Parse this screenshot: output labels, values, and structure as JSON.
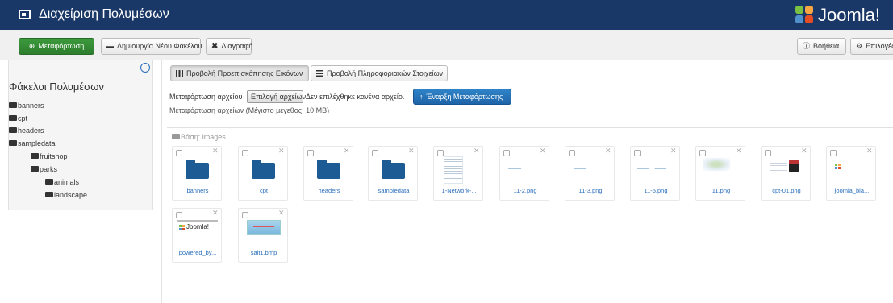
{
  "header": {
    "title": "Διαχείριση Πολυμέσων",
    "title_icon": "media-icon",
    "logo_text": "Joomla!",
    "colors": {
      "bar": "#1a3867",
      "logo_red": "#e44d26",
      "logo_orange": "#f9a541",
      "logo_green": "#7ac143",
      "logo_blue": "#5091cd"
    }
  },
  "toolbar": {
    "upload_label": "Μεταφόρτωση",
    "new_folder_label": "Δημιουργία Νέου Φακέλου",
    "delete_label": "Διαγραφή",
    "help_label": "Βοήθεια",
    "options_label": "Επιλογές"
  },
  "sidebar": {
    "title": "Φάκελοι Πολυμέσων",
    "items": [
      {
        "label": "banners"
      },
      {
        "label": "cpt"
      },
      {
        "label": "headers"
      },
      {
        "label": "sampledata"
      },
      {
        "label": "fruitshop"
      },
      {
        "label": "parks"
      },
      {
        "label": "animals"
      },
      {
        "label": "landscape"
      }
    ]
  },
  "main": {
    "tabs": [
      {
        "label": "Προβολή Προεπισκόπησης Εικόνων",
        "active": true
      },
      {
        "label": "Προβολή Πληροφοριακών Στοιχείων",
        "active": false
      }
    ],
    "upload": {
      "file_label": "Μεταφόρτωση αρχείου",
      "choose_label": "Επιλογή αρχείων",
      "no_file_label": "Δεν επιλέχθηκε κανένα αρχείο.",
      "start_label": "Έναρξη Μεταφόρτωσης",
      "max_size_label": "Μεταφόρτωση αρχείων (Μέγιστο μέγεθος: 10 MB)"
    },
    "base_path": "Βάση: images",
    "items": [
      {
        "name": "banners",
        "kind": "folder"
      },
      {
        "name": "cpt",
        "kind": "folder"
      },
      {
        "name": "headers",
        "kind": "folder"
      },
      {
        "name": "sampledata",
        "kind": "folder"
      },
      {
        "name": "1-Network-...",
        "kind": "image"
      },
      {
        "name": "11-2.png",
        "kind": "image"
      },
      {
        "name": "11-3.png",
        "kind": "image"
      },
      {
        "name": "11-5.png",
        "kind": "image"
      },
      {
        "name": "11.png",
        "kind": "image"
      },
      {
        "name": "cpt-01.png",
        "kind": "image"
      },
      {
        "name": "joomla_bla...",
        "kind": "image"
      },
      {
        "name": "powered_by...",
        "kind": "image"
      },
      {
        "name": "sait1.bmp",
        "kind": "image"
      }
    ],
    "powered_logo_text": "Joomla!"
  }
}
